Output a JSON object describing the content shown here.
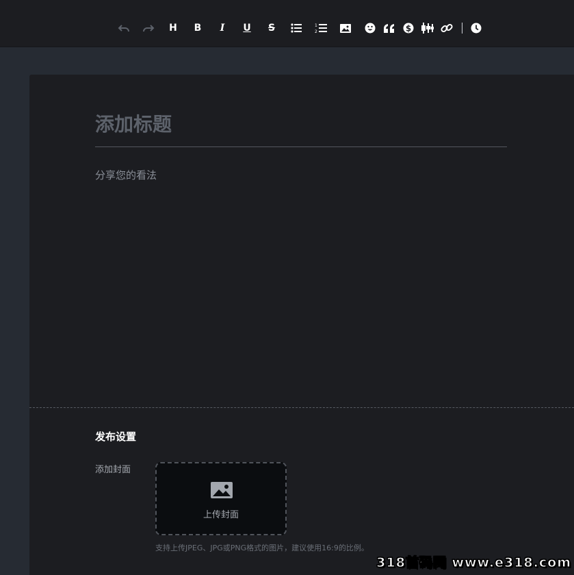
{
  "toolbar": {
    "buttons": [
      {
        "name": "undo",
        "icon": "undo-icon",
        "enabled": false
      },
      {
        "name": "redo",
        "icon": "redo-icon",
        "enabled": false
      },
      {
        "name": "heading",
        "icon": "heading-icon",
        "label": "H"
      },
      {
        "name": "bold",
        "icon": "bold-icon",
        "label": "B"
      },
      {
        "name": "italic",
        "icon": "italic-icon",
        "label": "I"
      },
      {
        "name": "underline",
        "icon": "underline-icon",
        "label": "U"
      },
      {
        "name": "strikethrough",
        "icon": "strikethrough-icon",
        "label": "S"
      },
      {
        "name": "bullet-list",
        "icon": "bullet-list-icon"
      },
      {
        "name": "numbered-list",
        "icon": "numbered-list-icon"
      },
      {
        "name": "image",
        "icon": "image-icon"
      },
      {
        "name": "emoji",
        "icon": "emoji-icon"
      },
      {
        "name": "quote",
        "icon": "quote-icon"
      },
      {
        "name": "dollar",
        "icon": "dollar-icon"
      },
      {
        "name": "candlestick",
        "icon": "candlestick-icon"
      },
      {
        "name": "link",
        "icon": "link-icon"
      },
      {
        "name": "history",
        "icon": "clock-icon"
      }
    ]
  },
  "editor": {
    "title_placeholder": "添加标题",
    "body_placeholder": "分享您的看法"
  },
  "publish": {
    "section_title": "发布设置",
    "cover_label": "添加封面",
    "upload_label": "上传封面",
    "hint": "支持上传JPEG、JPG或PNG格式的图片，建议使用16:9的比例。"
  },
  "watermark": "318首码网 www.e318.com",
  "colors": {
    "toolbar_bg": "#1c1d21",
    "page_bg": "#262b33",
    "panel_bg": "#1c1d21",
    "upload_bg": "#0b0d10",
    "disabled_icon": "#5d626b"
  }
}
